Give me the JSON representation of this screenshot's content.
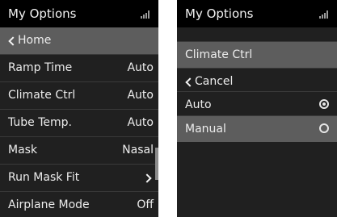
{
  "left_screen": {
    "title": "My Options",
    "home_label": "Home",
    "items": [
      {
        "label": "Ramp Time",
        "value": "Auto"
      },
      {
        "label": "Climate Ctrl",
        "value": "Auto"
      },
      {
        "label": "Tube Temp.",
        "value": "Auto"
      },
      {
        "label": "Mask",
        "value": "Nasal"
      },
      {
        "label": "Run Mask Fit",
        "value": ""
      },
      {
        "label": "Airplane Mode",
        "value": "Off"
      }
    ]
  },
  "right_screen": {
    "title": "My Options",
    "header": "Climate Ctrl",
    "cancel_label": "Cancel",
    "options": [
      {
        "label": "Auto",
        "selected": true
      },
      {
        "label": "Manual",
        "selected": false
      }
    ]
  },
  "colors": {
    "screen_bg": "#202020",
    "titlebar_bg": "#000000",
    "highlight_bg": "#5d5d5d",
    "text": "#ececec"
  },
  "icons": {
    "signal": "signal-strength-icon",
    "back": "chevron-left-icon",
    "forward": "chevron-right-icon",
    "radio": "radio-button-icon"
  }
}
